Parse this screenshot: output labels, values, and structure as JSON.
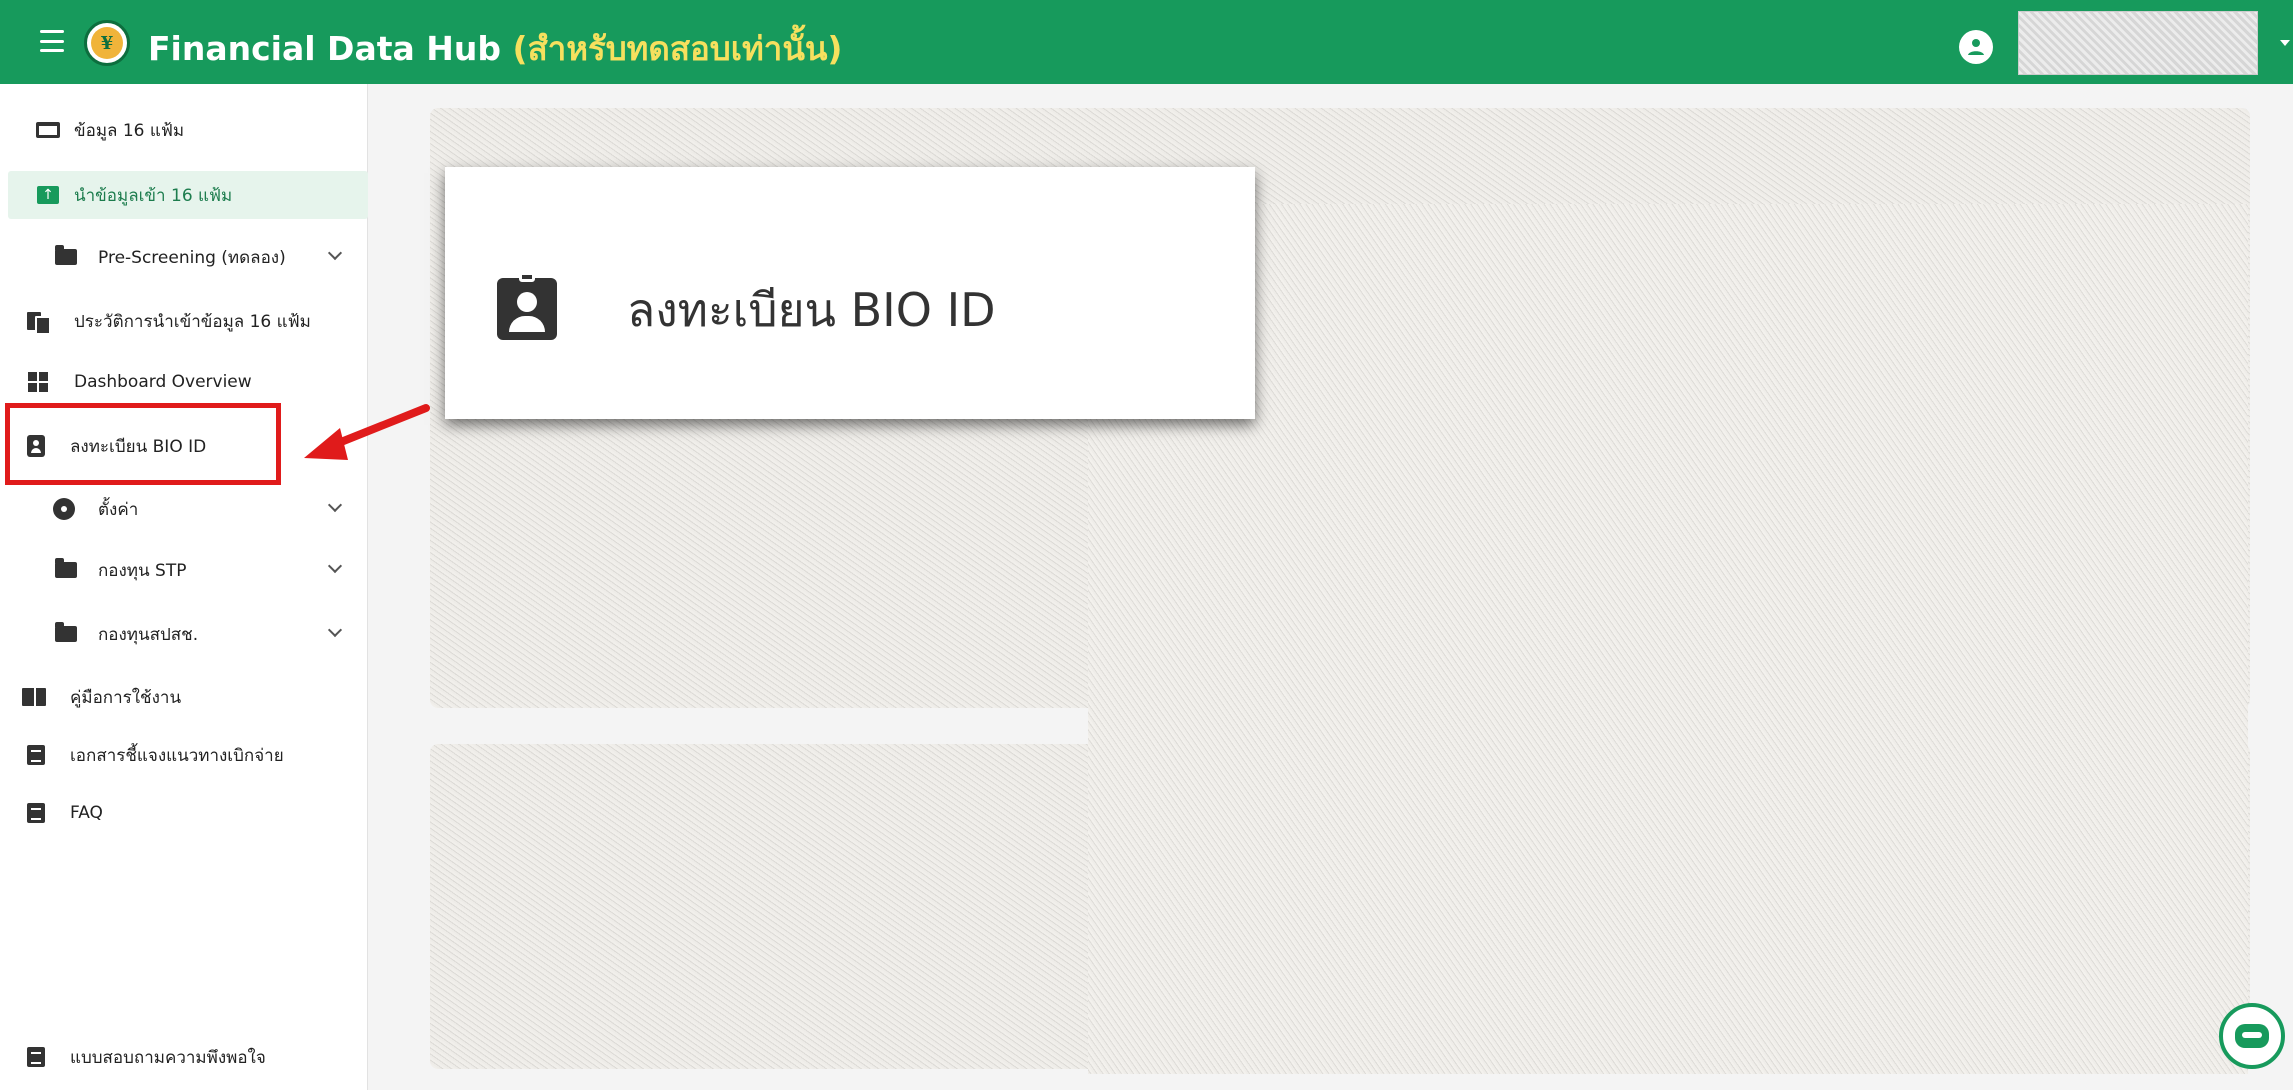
{
  "header": {
    "title": "Financial Data Hub",
    "subtitle": "(สำหรับทดสอบเท่านั้น)",
    "brand_color": "#179a5c",
    "subtitle_color": "#f6e05e"
  },
  "sidebar": {
    "items": [
      {
        "label": "ข้อมูล 16 แฟ้ม",
        "icon": "folder-open-icon"
      },
      {
        "label": "นำข้อมูลเข้า 16 แฟ้ม",
        "icon": "folder-upload-icon",
        "active": true
      },
      {
        "label": "Pre-Screening (ทดลอง)",
        "icon": "folder-icon"
      },
      {
        "label": "ประวัติการนำเข้าข้อมูล 16 แฟ้ม",
        "icon": "file-copy-icon"
      },
      {
        "label": "Dashboard Overview",
        "icon": "dashboard-icon"
      },
      {
        "label": "ลงทะเบียน BIO ID",
        "icon": "badge-icon"
      },
      {
        "label": "ตั้งค่า",
        "icon": "gear-icon"
      },
      {
        "label": "กองทุน STP",
        "icon": "folder-icon"
      },
      {
        "label": "กองทุนสปสช.",
        "icon": "folder-icon"
      },
      {
        "label": "คู่มือการใช้งาน",
        "icon": "book-icon"
      },
      {
        "label": "เอกสารชี้แจงแนวทางเบิกจ่าย",
        "icon": "document-icon"
      },
      {
        "label": "FAQ",
        "icon": "document-icon"
      },
      {
        "label": "แบบสอบถามความพึงพอใจ",
        "icon": "document-icon"
      }
    ],
    "highlight_color": "#e01b1b"
  },
  "zoom": {
    "label": "ลงทะเบียน BIO ID",
    "icon": "badge-icon"
  }
}
